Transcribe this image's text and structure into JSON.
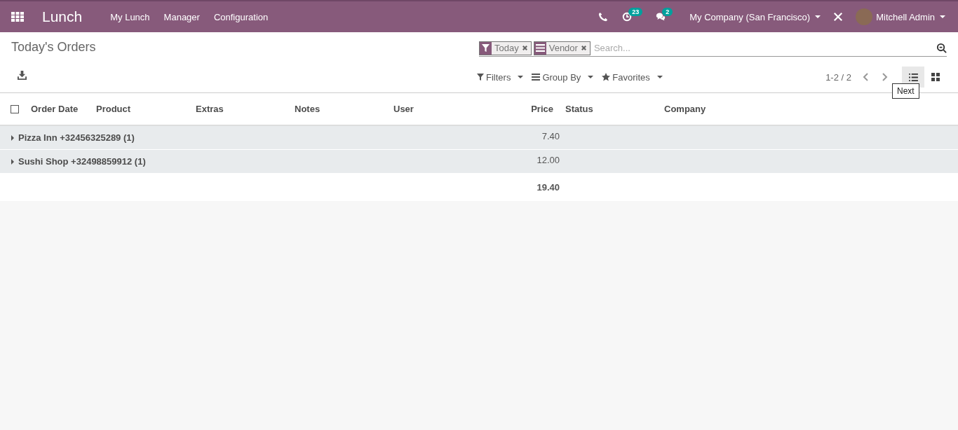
{
  "navbar": {
    "app_name": "Lunch",
    "menu": [
      "My Lunch",
      "Manager",
      "Configuration"
    ],
    "activity_count": "23",
    "message_count": "2",
    "company": "My Company (San Francisco)",
    "user": "Mitchell Admin"
  },
  "control_panel": {
    "title": "Today's Orders",
    "facets": [
      {
        "kind": "filter",
        "label": "Today"
      },
      {
        "kind": "groupby",
        "label": "Vendor"
      }
    ],
    "search": {
      "placeholder": "Search..."
    },
    "search_options": [
      {
        "kind": "filter",
        "label": "Filters"
      },
      {
        "kind": "groupby",
        "label": "Group By"
      },
      {
        "kind": "favorite",
        "label": "Favorites"
      }
    ],
    "pager": "1-2 / 2",
    "views": [
      {
        "kind": "list",
        "selected": true
      },
      {
        "kind": "kanban",
        "selected": false
      }
    ],
    "tooltip": "Next"
  },
  "table": {
    "select_all_checked": false,
    "columns": [
      {
        "label": "Order Date",
        "kind": "text"
      },
      {
        "label": "Product",
        "kind": "text"
      },
      {
        "label": "Extras",
        "kind": "text"
      },
      {
        "label": "Notes",
        "kind": "text"
      },
      {
        "label": "User",
        "kind": "text"
      },
      {
        "label": "Price",
        "kind": "number"
      },
      {
        "label": "Status",
        "kind": "text"
      },
      {
        "label": "Company",
        "kind": "text"
      }
    ],
    "groups": [
      {
        "name": "Pizza Inn +32456325289 (1)",
        "price": "7.40",
        "expanded": false
      },
      {
        "name": "Sushi Shop +32498859912 (1)",
        "price": "12.00",
        "expanded": false
      }
    ],
    "total": "19.40"
  }
}
